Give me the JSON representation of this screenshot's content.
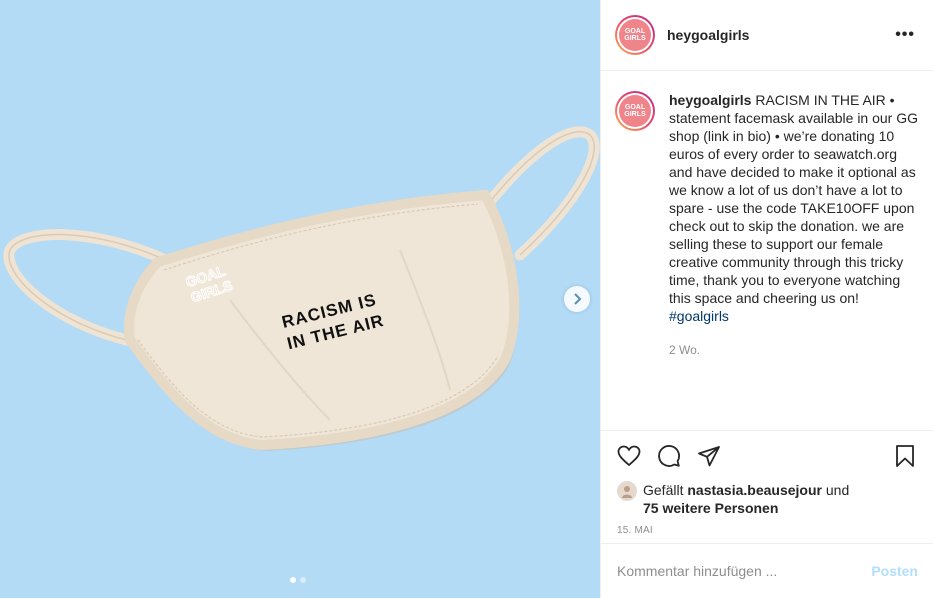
{
  "media": {
    "mask_print": [
      "RACISM IS",
      "IN THE AIR"
    ],
    "mask_logo": [
      "GOAL",
      "GIRLS"
    ]
  },
  "header": {
    "username": "heygoalgirls",
    "avatar_text": [
      "GOAL",
      "GIRLS"
    ],
    "more_icon": "more-horizontal-icon"
  },
  "caption": {
    "username": "heygoalgirls",
    "text": " RACISM IN THE AIR • statement facemask available in our GG shop (link in bio) • we’re donating 10 euros of every order to seawatch.org and have decided to make it optional as we know a lot of us don’t have a lot to spare - use the code TAKE10OFF upon check out to skip the donation. we are selling these to support our female creative community through this tricky time, thank you to everyone watching this space and cheering us on! ",
    "hashtag": "#goalgirls",
    "time_ago": "2 Wo."
  },
  "actions": {
    "like_icon": "heart-icon",
    "comment_icon": "comment-icon",
    "share_icon": "paper-plane-icon",
    "save_icon": "bookmark-icon"
  },
  "likes": {
    "prefix": "Gefällt ",
    "user": "nastasia.beausejour",
    "middle": " und",
    "others": "75 weitere Personen"
  },
  "date": "15. MAI",
  "comment": {
    "placeholder": "Kommentar hinzufügen ...",
    "post_label": "Posten"
  },
  "colors": {
    "background": "#b3dbf6",
    "brand_pink": "#f0848b",
    "link": "#00376b",
    "post_disabled": "#b2dffc"
  }
}
